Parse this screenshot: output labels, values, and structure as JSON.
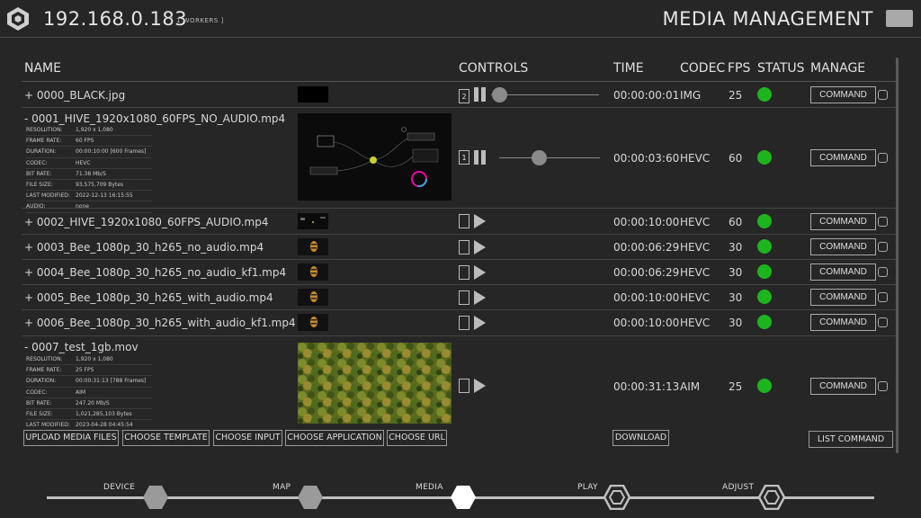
{
  "header": {
    "ip": "192.168.0.183",
    "workers": "[ 1 WORKERS ]",
    "title": "MEDIA MANAGEMENT",
    "logo_icon": "hive-logo-icon",
    "menu_icon": "menu-toggle-icon"
  },
  "columns": {
    "name": "NAME",
    "controls": "CONTROLS",
    "time": "TIME",
    "codec": "CODEC",
    "fps": "FPS",
    "status": "STATUS",
    "manage": "MANAGE"
  },
  "meta_labels": {
    "resolution": "RESOLUTION:",
    "frame_rate": "FRAME RATE:",
    "duration": "DURATION:",
    "codec": "CODEC:",
    "bit_rate": "BIT RATE:",
    "file_size": "FILE SIZE:",
    "last_modified": "LAST MODIFIED:",
    "audio": "AUDIO:"
  },
  "rows": [
    {
      "name": "+ 0000_BLACK.jpg",
      "time": "00:00:00:01",
      "codec": "IMG",
      "fps": "25",
      "command": "COMMAND",
      "layer": "2",
      "status_color": "#1db51d"
    },
    {
      "name": "- 0001_HIVE_1920x1080_60FPS_NO_AUDIO.mp4",
      "time": "00:00:03:60",
      "codec": "HEVC",
      "fps": "60",
      "command": "COMMAND",
      "layer": "1",
      "status_color": "#1db51d",
      "meta": {
        "resolution": "1,920 x 1,080",
        "frame_rate": "60 FPS",
        "duration": "00:00:10:00 [600 Frames]",
        "codec": "HEVC",
        "bit_rate": "71.38 Mb/S",
        "file_size": "93,575,709 Bytes",
        "last_modified": "2022-12-13 16:15:55",
        "audio": "none"
      }
    },
    {
      "name": "+ 0002_HIVE_1920x1080_60FPS_AUDIO.mp4",
      "time": "00:00:10:00",
      "codec": "HEVC",
      "fps": "60",
      "command": "COMMAND",
      "status_color": "#1db51d"
    },
    {
      "name": "+ 0003_Bee_1080p_30_h265_no_audio.mp4",
      "time": "00:00:06:29",
      "codec": "HEVC",
      "fps": "30",
      "command": "COMMAND",
      "status_color": "#1db51d"
    },
    {
      "name": "+ 0004_Bee_1080p_30_h265_no_audio_kf1.mp4",
      "time": "00:00:06:29",
      "codec": "HEVC",
      "fps": "30",
      "command": "COMMAND",
      "status_color": "#1db51d"
    },
    {
      "name": "+ 0005_Bee_1080p_30_h265_with_audio.mp4",
      "time": "00:00:10:00",
      "codec": "HEVC",
      "fps": "30",
      "command": "COMMAND",
      "status_color": "#1db51d"
    },
    {
      "name": "+ 0006_Bee_1080p_30_h265_with_audio_kf1.mp4",
      "time": "00:00:10:00",
      "codec": "HEVC",
      "fps": "30",
      "command": "COMMAND",
      "status_color": "#1db51d"
    },
    {
      "name": "- 0007_test_1gb.mov",
      "time": "00:00:31:13",
      "codec": "AIM",
      "fps": "25",
      "command": "COMMAND",
      "status_color": "#1db51d",
      "meta": {
        "resolution": "1,920 x 1,080",
        "frame_rate": "25 FPS",
        "duration": "00:00:31:13 [788 Frames]",
        "codec": "AIM",
        "bit_rate": "247.20 Mb/S",
        "file_size": "1,021,285,103 Bytes",
        "last_modified": "2023-04-28 04:45:54"
      }
    }
  ],
  "buttons": {
    "upload": "UPLOAD MEDIA FILES",
    "template": "CHOOSE TEMPLATE",
    "input": "CHOOSE INPUT",
    "application": "CHOOSE APPLICATION",
    "url": "CHOOSE URL",
    "download": "DOWNLOAD",
    "list_command": "LIST COMMAND"
  },
  "nav": {
    "device": "DEVICE",
    "map": "MAP",
    "media": "MEDIA",
    "play": "PLAY",
    "adjust": "ADJUST",
    "active": "MEDIA"
  },
  "colors": {
    "background": "#262626",
    "status_ok": "#1db51d",
    "text": "#d8d8d8"
  }
}
